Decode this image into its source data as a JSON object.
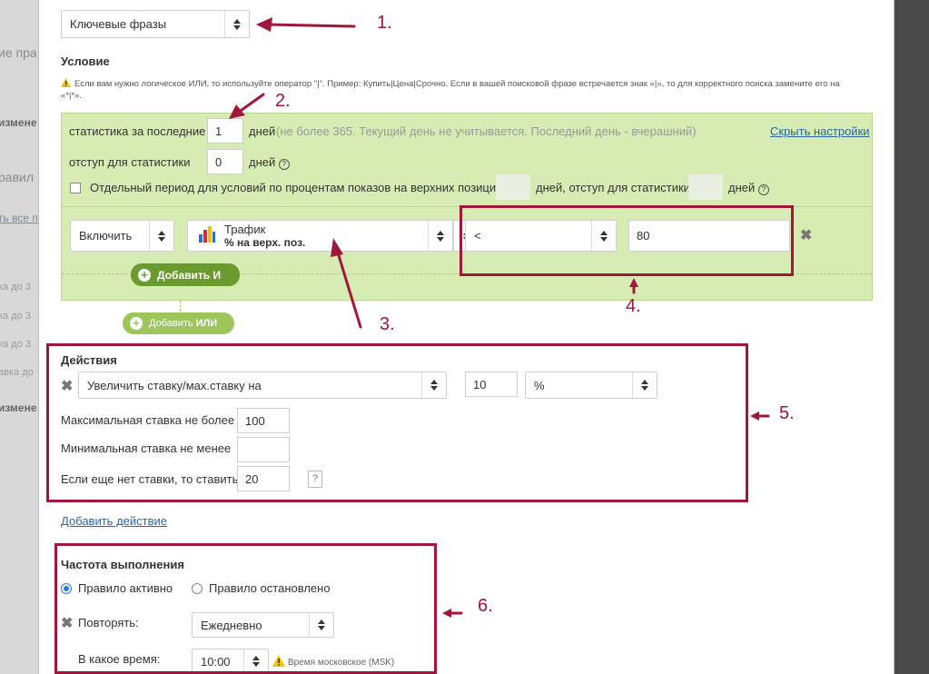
{
  "background": {
    "fragments": [
      "ие пра",
      "измене",
      "равил",
      "ть все п",
      "ка до 3",
      "ка до 3",
      "ка до 3",
      "авка до",
      "измене"
    ]
  },
  "top_select": {
    "value": "Ключевые фразы"
  },
  "condition": {
    "heading": "Условие",
    "hint": "Если вам нужно логическое ИЛИ, то используйте оператор \"|\". Пример: Купить|Цена|Срочно. Если в вашей поисковой фразе встречается знак «|», то для корректного поиска замените его на «*|*».",
    "stats_label": "статистика за последние",
    "stats_value": "1",
    "days": "дней",
    "stats_hint": "(не более 365. Текущий день не учитывается. Последний день - вчерашний)",
    "hide_settings": "Скрыть настройки",
    "offset_label": "отступ для статистики",
    "offset_value": "0",
    "separate_period_label": "Отдельный период для условий по процентам показов на верхних позициях",
    "days_offset_label": "дней, отступ для статистики",
    "rule": {
      "include": "Включить",
      "metric_line1": "Трафик",
      "metric_line2": "% на верх. поз.",
      "operator": "<",
      "value": "80"
    },
    "add_and": "Добавить И",
    "add_or_prefix": "Добавить ",
    "add_or_bold": "ИЛИ"
  },
  "actions": {
    "heading": "Действия",
    "action_select": "Увеличить ставку/мах.ставку на",
    "amount": "10",
    "unit": "%",
    "max_bid_label": "Максимальная ставка не более",
    "max_bid_value": "100",
    "min_bid_label": "Минимальная ставка не менее",
    "min_bid_value": "",
    "no_bid_label": "Если еще нет ставки, то ставить",
    "no_bid_value": "20",
    "help": "?",
    "add_action": "Добавить действие"
  },
  "frequency": {
    "heading": "Частота выполнения",
    "active_label": "Правило активно",
    "stopped_label": "Правило остановлено",
    "repeat_label": "Повторять:",
    "repeat_value": "Ежедневно",
    "time_label": "В какое время:",
    "time_value": "10:00",
    "timezone_note": "Время московское (MSK)"
  },
  "annotations": [
    "1.",
    "2.",
    "3.",
    "4.",
    "5.",
    "6."
  ],
  "colors": {
    "annotation": "#a0173a",
    "green_area": "#d6ecb2",
    "green_button": "#6b9a2e",
    "link": "#2a66a0"
  }
}
